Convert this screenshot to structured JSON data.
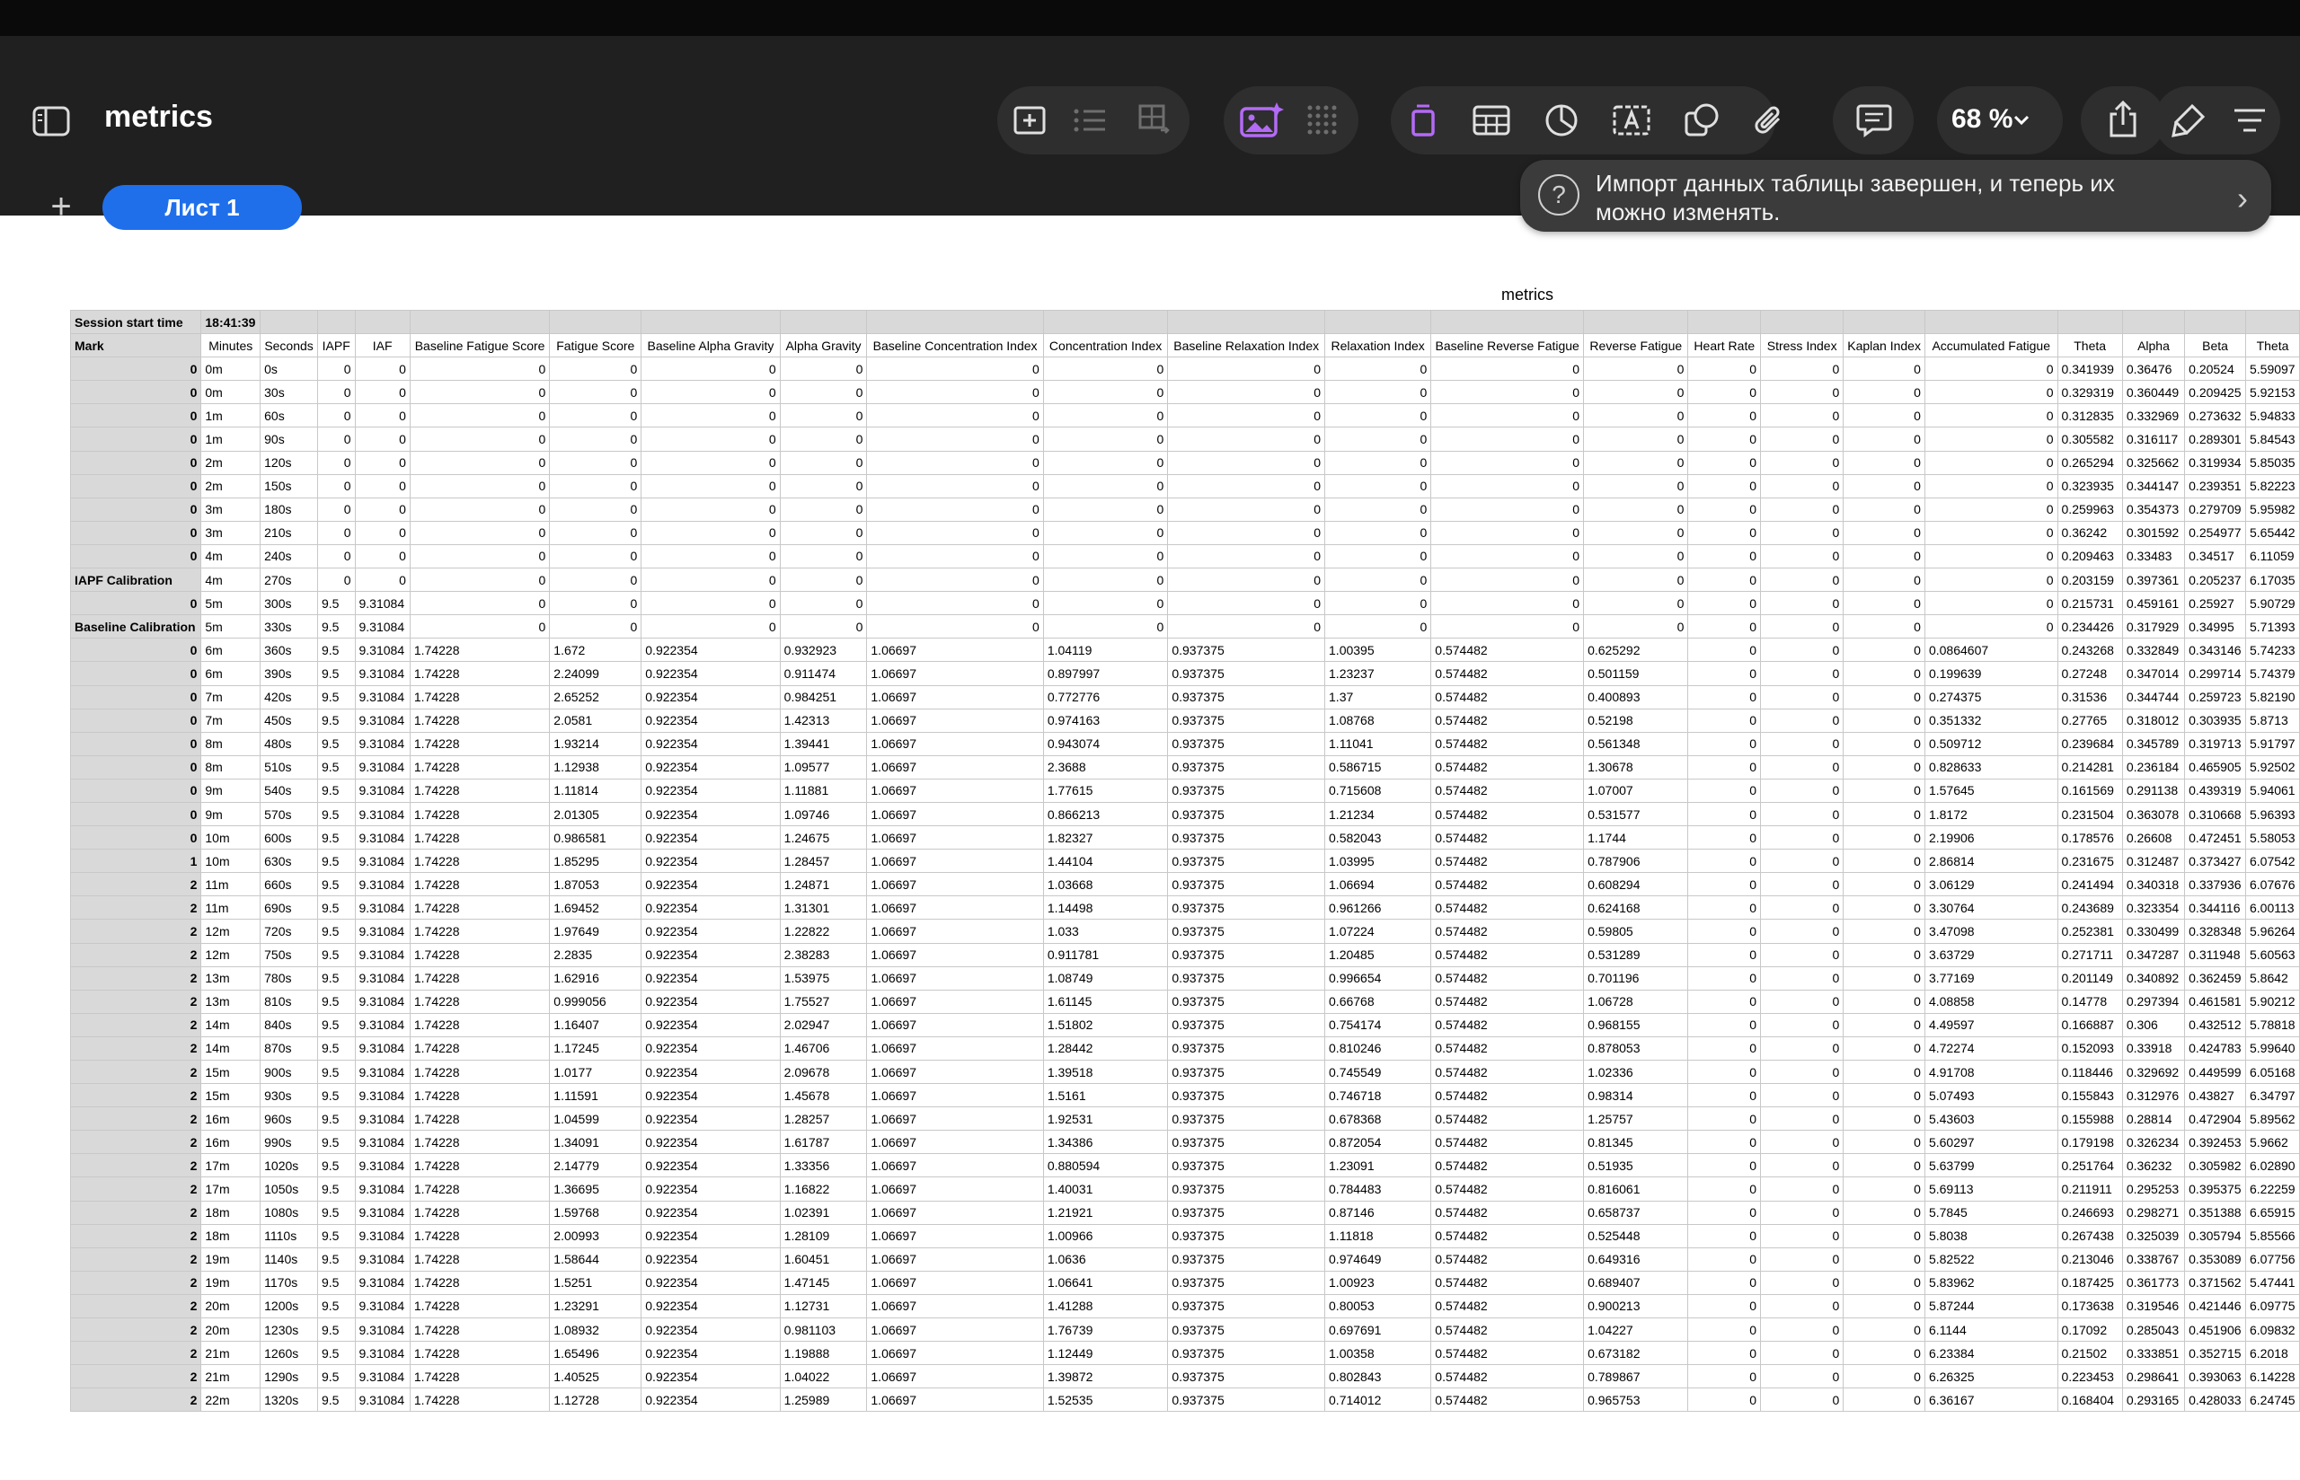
{
  "app": {
    "document_title": "metrics",
    "zoom_label": "68 %",
    "sheet_tab_label": "Лист 1",
    "notice_text": "Импорт данных таблицы завершен, и теперь их можно изменять."
  },
  "icons": {
    "sidebar": "sidebar-icon",
    "insert": "insert-icon",
    "list": "list-icon",
    "table_ops": "table-ops-icon",
    "image": "image-ai-icon",
    "grid": "grid-icon",
    "page": "page-icon",
    "table": "table-icon",
    "chart": "chart-icon",
    "textbox": "text-box-icon",
    "shape": "shape-icon",
    "attach": "paperclip-icon",
    "comment": "comment-icon",
    "share": "share-icon",
    "format": "format-brush-icon",
    "menu": "menu-icon"
  },
  "colors": {
    "accent": "#1f6feb",
    "image_icon": "#b36bf5",
    "header_gray": "#d9d9d9"
  },
  "sheet": {
    "title": "metrics",
    "session_label": "Session start time",
    "session_value": "18:41:39",
    "headers": [
      "Mark",
      "Minutes",
      "Seconds",
      "IAPF",
      "IAF",
      "Baseline Fatigue Score",
      "Fatigue Score",
      "Baseline Alpha Gravity",
      "Alpha Gravity",
      "Baseline Concentration Index",
      "Concentration Index",
      "Baseline Relaxation Index",
      "Relaxation Index",
      "Baseline Reverse Fatigue",
      "Reverse Fatigue",
      "Heart Rate",
      "Stress Index",
      "Kaplan Index",
      "Accumulated Fatigue",
      "Theta",
      "Alpha",
      "Beta",
      "Theta"
    ],
    "rows": [
      [
        "0",
        "0m",
        "0s",
        "0",
        "0",
        "0",
        "0",
        "0",
        "0",
        "0",
        "0",
        "0",
        "0",
        "0",
        "0",
        "0",
        "0",
        "0",
        "0",
        "0.341939",
        "0.36476",
        "0.20524",
        "5.59097"
      ],
      [
        "0",
        "0m",
        "30s",
        "0",
        "0",
        "0",
        "0",
        "0",
        "0",
        "0",
        "0",
        "0",
        "0",
        "0",
        "0",
        "0",
        "0",
        "0",
        "0",
        "0.329319",
        "0.360449",
        "0.209425",
        "5.92153"
      ],
      [
        "0",
        "1m",
        "60s",
        "0",
        "0",
        "0",
        "0",
        "0",
        "0",
        "0",
        "0",
        "0",
        "0",
        "0",
        "0",
        "0",
        "0",
        "0",
        "0",
        "0.312835",
        "0.332969",
        "0.273632",
        "5.94833"
      ],
      [
        "0",
        "1m",
        "90s",
        "0",
        "0",
        "0",
        "0",
        "0",
        "0",
        "0",
        "0",
        "0",
        "0",
        "0",
        "0",
        "0",
        "0",
        "0",
        "0",
        "0.305582",
        "0.316117",
        "0.289301",
        "5.84543"
      ],
      [
        "0",
        "2m",
        "120s",
        "0",
        "0",
        "0",
        "0",
        "0",
        "0",
        "0",
        "0",
        "0",
        "0",
        "0",
        "0",
        "0",
        "0",
        "0",
        "0",
        "0.265294",
        "0.325662",
        "0.319934",
        "5.85035"
      ],
      [
        "0",
        "2m",
        "150s",
        "0",
        "0",
        "0",
        "0",
        "0",
        "0",
        "0",
        "0",
        "0",
        "0",
        "0",
        "0",
        "0",
        "0",
        "0",
        "0",
        "0.323935",
        "0.344147",
        "0.239351",
        "5.82223"
      ],
      [
        "0",
        "3m",
        "180s",
        "0",
        "0",
        "0",
        "0",
        "0",
        "0",
        "0",
        "0",
        "0",
        "0",
        "0",
        "0",
        "0",
        "0",
        "0",
        "0",
        "0.259963",
        "0.354373",
        "0.279709",
        "5.95982"
      ],
      [
        "0",
        "3m",
        "210s",
        "0",
        "0",
        "0",
        "0",
        "0",
        "0",
        "0",
        "0",
        "0",
        "0",
        "0",
        "0",
        "0",
        "0",
        "0",
        "0",
        "0.36242",
        "0.301592",
        "0.254977",
        "5.65442"
      ],
      [
        "0",
        "4m",
        "240s",
        "0",
        "0",
        "0",
        "0",
        "0",
        "0",
        "0",
        "0",
        "0",
        "0",
        "0",
        "0",
        "0",
        "0",
        "0",
        "0",
        "0.209463",
        "0.33483",
        "0.34517",
        "6.11059"
      ],
      [
        "IAPF Calibration",
        "4m",
        "270s",
        "0",
        "0",
        "0",
        "0",
        "0",
        "0",
        "0",
        "0",
        "0",
        "0",
        "0",
        "0",
        "0",
        "0",
        "0",
        "0",
        "0.203159",
        "0.397361",
        "0.205237",
        "6.17035"
      ],
      [
        "0",
        "5m",
        "300s",
        "9.5",
        "9.31084",
        "0",
        "0",
        "0",
        "0",
        "0",
        "0",
        "0",
        "0",
        "0",
        "0",
        "0",
        "0",
        "0",
        "0",
        "0.215731",
        "0.459161",
        "0.25927",
        "5.90729"
      ],
      [
        "Baseline Calibration",
        "5m",
        "330s",
        "9.5",
        "9.31084",
        "0",
        "0",
        "0",
        "0",
        "0",
        "0",
        "0",
        "0",
        "0",
        "0",
        "0",
        "0",
        "0",
        "0",
        "0.234426",
        "0.317929",
        "0.34995",
        "5.71393"
      ],
      [
        "0",
        "6m",
        "360s",
        "9.5",
        "9.31084",
        "1.74228",
        "1.672",
        "0.922354",
        "0.932923",
        "1.06697",
        "1.04119",
        "0.937375",
        "1.00395",
        "0.574482",
        "0.625292",
        "0",
        "0",
        "0",
        "0.0864607",
        "0.243268",
        "0.332849",
        "0.343146",
        "5.74233"
      ],
      [
        "0",
        "6m",
        "390s",
        "9.5",
        "9.31084",
        "1.74228",
        "2.24099",
        "0.922354",
        "0.911474",
        "1.06697",
        "0.897997",
        "0.937375",
        "1.23237",
        "0.574482",
        "0.501159",
        "0",
        "0",
        "0",
        "0.199639",
        "0.27248",
        "0.347014",
        "0.299714",
        "5.74379"
      ],
      [
        "0",
        "7m",
        "420s",
        "9.5",
        "9.31084",
        "1.74228",
        "2.65252",
        "0.922354",
        "0.984251",
        "1.06697",
        "0.772776",
        "0.937375",
        "1.37",
        "0.574482",
        "0.400893",
        "0",
        "0",
        "0",
        "0.274375",
        "0.31536",
        "0.344744",
        "0.259723",
        "5.82190"
      ],
      [
        "0",
        "7m",
        "450s",
        "9.5",
        "9.31084",
        "1.74228",
        "2.0581",
        "0.922354",
        "1.42313",
        "1.06697",
        "0.974163",
        "0.937375",
        "1.08768",
        "0.574482",
        "0.52198",
        "0",
        "0",
        "0",
        "0.351332",
        "0.27765",
        "0.318012",
        "0.303935",
        "5.8713"
      ],
      [
        "0",
        "8m",
        "480s",
        "9.5",
        "9.31084",
        "1.74228",
        "1.93214",
        "0.922354",
        "1.39441",
        "1.06697",
        "0.943074",
        "0.937375",
        "1.11041",
        "0.574482",
        "0.561348",
        "0",
        "0",
        "0",
        "0.509712",
        "0.239684",
        "0.345789",
        "0.319713",
        "5.91797"
      ],
      [
        "0",
        "8m",
        "510s",
        "9.5",
        "9.31084",
        "1.74228",
        "1.12938",
        "0.922354",
        "1.09577",
        "1.06697",
        "2.3688",
        "0.937375",
        "0.586715",
        "0.574482",
        "1.30678",
        "0",
        "0",
        "0",
        "0.828633",
        "0.214281",
        "0.236184",
        "0.465905",
        "5.92502"
      ],
      [
        "0",
        "9m",
        "540s",
        "9.5",
        "9.31084",
        "1.74228",
        "1.11814",
        "0.922354",
        "1.11881",
        "1.06697",
        "1.77615",
        "0.937375",
        "0.715608",
        "0.574482",
        "1.07007",
        "0",
        "0",
        "0",
        "1.57645",
        "0.161569",
        "0.291138",
        "0.439319",
        "5.94061"
      ],
      [
        "0",
        "9m",
        "570s",
        "9.5",
        "9.31084",
        "1.74228",
        "2.01305",
        "0.922354",
        "1.09746",
        "1.06697",
        "0.866213",
        "0.937375",
        "1.21234",
        "0.574482",
        "0.531577",
        "0",
        "0",
        "0",
        "1.8172",
        "0.231504",
        "0.363078",
        "0.310668",
        "5.96393"
      ],
      [
        "0",
        "10m",
        "600s",
        "9.5",
        "9.31084",
        "1.74228",
        "0.986581",
        "0.922354",
        "1.24675",
        "1.06697",
        "1.82327",
        "0.937375",
        "0.582043",
        "0.574482",
        "1.1744",
        "0",
        "0",
        "0",
        "2.19906",
        "0.178576",
        "0.26608",
        "0.472451",
        "5.58053"
      ],
      [
        "1",
        "10m",
        "630s",
        "9.5",
        "9.31084",
        "1.74228",
        "1.85295",
        "0.922354",
        "1.28457",
        "1.06697",
        "1.44104",
        "0.937375",
        "1.03995",
        "0.574482",
        "0.787906",
        "0",
        "0",
        "0",
        "2.86814",
        "0.231675",
        "0.312487",
        "0.373427",
        "6.07542"
      ],
      [
        "2",
        "11m",
        "660s",
        "9.5",
        "9.31084",
        "1.74228",
        "1.87053",
        "0.922354",
        "1.24871",
        "1.06697",
        "1.03668",
        "0.937375",
        "1.06694",
        "0.574482",
        "0.608294",
        "0",
        "0",
        "0",
        "3.06129",
        "0.241494",
        "0.340318",
        "0.337936",
        "6.07676"
      ],
      [
        "2",
        "11m",
        "690s",
        "9.5",
        "9.31084",
        "1.74228",
        "1.69452",
        "0.922354",
        "1.31301",
        "1.06697",
        "1.14498",
        "0.937375",
        "0.961266",
        "0.574482",
        "0.624168",
        "0",
        "0",
        "0",
        "3.30764",
        "0.243689",
        "0.323354",
        "0.344116",
        "6.00113"
      ],
      [
        "2",
        "12m",
        "720s",
        "9.5",
        "9.31084",
        "1.74228",
        "1.97649",
        "0.922354",
        "1.22822",
        "1.06697",
        "1.033",
        "0.937375",
        "1.07224",
        "0.574482",
        "0.59805",
        "0",
        "0",
        "0",
        "3.47098",
        "0.252381",
        "0.330499",
        "0.328348",
        "5.96264"
      ],
      [
        "2",
        "12m",
        "750s",
        "9.5",
        "9.31084",
        "1.74228",
        "2.2835",
        "0.922354",
        "2.38283",
        "1.06697",
        "0.911781",
        "0.937375",
        "1.20485",
        "0.574482",
        "0.531289",
        "0",
        "0",
        "0",
        "3.63729",
        "0.271711",
        "0.347287",
        "0.311948",
        "5.60563"
      ],
      [
        "2",
        "13m",
        "780s",
        "9.5",
        "9.31084",
        "1.74228",
        "1.62916",
        "0.922354",
        "1.53975",
        "1.06697",
        "1.08749",
        "0.937375",
        "0.996654",
        "0.574482",
        "0.701196",
        "0",
        "0",
        "0",
        "3.77169",
        "0.201149",
        "0.340892",
        "0.362459",
        "5.8642"
      ],
      [
        "2",
        "13m",
        "810s",
        "9.5",
        "9.31084",
        "1.74228",
        "0.999056",
        "0.922354",
        "1.75527",
        "1.06697",
        "1.61145",
        "0.937375",
        "0.66768",
        "0.574482",
        "1.06728",
        "0",
        "0",
        "0",
        "4.08858",
        "0.14778",
        "0.297394",
        "0.461581",
        "5.90212"
      ],
      [
        "2",
        "14m",
        "840s",
        "9.5",
        "9.31084",
        "1.74228",
        "1.16407",
        "0.922354",
        "2.02947",
        "1.06697",
        "1.51802",
        "0.937375",
        "0.754174",
        "0.574482",
        "0.968155",
        "0",
        "0",
        "0",
        "4.49597",
        "0.166887",
        "0.306",
        "0.432512",
        "5.78818"
      ],
      [
        "2",
        "14m",
        "870s",
        "9.5",
        "9.31084",
        "1.74228",
        "1.17245",
        "0.922354",
        "1.46706",
        "1.06697",
        "1.28442",
        "0.937375",
        "0.810246",
        "0.574482",
        "0.878053",
        "0",
        "0",
        "0",
        "4.72274",
        "0.152093",
        "0.33918",
        "0.424783",
        "5.99640"
      ],
      [
        "2",
        "15m",
        "900s",
        "9.5",
        "9.31084",
        "1.74228",
        "1.0177",
        "0.922354",
        "2.09678",
        "1.06697",
        "1.39518",
        "0.937375",
        "0.745549",
        "0.574482",
        "1.02336",
        "0",
        "0",
        "0",
        "4.91708",
        "0.118446",
        "0.329692",
        "0.449599",
        "6.05168"
      ],
      [
        "2",
        "15m",
        "930s",
        "9.5",
        "9.31084",
        "1.74228",
        "1.11591",
        "0.922354",
        "1.45678",
        "1.06697",
        "1.5161",
        "0.937375",
        "0.746718",
        "0.574482",
        "0.98314",
        "0",
        "0",
        "0",
        "5.07493",
        "0.155843",
        "0.312976",
        "0.43827",
        "6.34797"
      ],
      [
        "2",
        "16m",
        "960s",
        "9.5",
        "9.31084",
        "1.74228",
        "1.04599",
        "0.922354",
        "1.28257",
        "1.06697",
        "1.92531",
        "0.937375",
        "0.678368",
        "0.574482",
        "1.25757",
        "0",
        "0",
        "0",
        "5.43603",
        "0.155988",
        "0.28814",
        "0.472904",
        "5.89562"
      ],
      [
        "2",
        "16m",
        "990s",
        "9.5",
        "9.31084",
        "1.74228",
        "1.34091",
        "0.922354",
        "1.61787",
        "1.06697",
        "1.34386",
        "0.937375",
        "0.872054",
        "0.574482",
        "0.81345",
        "0",
        "0",
        "0",
        "5.60297",
        "0.179198",
        "0.326234",
        "0.392453",
        "5.9662"
      ],
      [
        "2",
        "17m",
        "1020s",
        "9.5",
        "9.31084",
        "1.74228",
        "2.14779",
        "0.922354",
        "1.33356",
        "1.06697",
        "0.880594",
        "0.937375",
        "1.23091",
        "0.574482",
        "0.51935",
        "0",
        "0",
        "0",
        "5.63799",
        "0.251764",
        "0.36232",
        "0.305982",
        "6.02890"
      ],
      [
        "2",
        "17m",
        "1050s",
        "9.5",
        "9.31084",
        "1.74228",
        "1.36695",
        "0.922354",
        "1.16822",
        "1.06697",
        "1.40031",
        "0.937375",
        "0.784483",
        "0.574482",
        "0.816061",
        "0",
        "0",
        "0",
        "5.69113",
        "0.211911",
        "0.295253",
        "0.395375",
        "6.22259"
      ],
      [
        "2",
        "18m",
        "1080s",
        "9.5",
        "9.31084",
        "1.74228",
        "1.59768",
        "0.922354",
        "1.02391",
        "1.06697",
        "1.21921",
        "0.937375",
        "0.87146",
        "0.574482",
        "0.658737",
        "0",
        "0",
        "0",
        "5.7845",
        "0.246693",
        "0.298271",
        "0.351388",
        "6.65915"
      ],
      [
        "2",
        "18m",
        "1110s",
        "9.5",
        "9.31084",
        "1.74228",
        "2.00993",
        "0.922354",
        "1.28109",
        "1.06697",
        "1.00966",
        "0.937375",
        "1.11818",
        "0.574482",
        "0.525448",
        "0",
        "0",
        "0",
        "5.8038",
        "0.267438",
        "0.325039",
        "0.305794",
        "5.85566"
      ],
      [
        "2",
        "19m",
        "1140s",
        "9.5",
        "9.31084",
        "1.74228",
        "1.58644",
        "0.922354",
        "1.60451",
        "1.06697",
        "1.0636",
        "0.937375",
        "0.974649",
        "0.574482",
        "0.649316",
        "0",
        "0",
        "0",
        "5.82522",
        "0.213046",
        "0.338767",
        "0.353089",
        "6.07756"
      ],
      [
        "2",
        "19m",
        "1170s",
        "9.5",
        "9.31084",
        "1.74228",
        "1.5251",
        "0.922354",
        "1.47145",
        "1.06697",
        "1.06641",
        "0.937375",
        "1.00923",
        "0.574482",
        "0.689407",
        "0",
        "0",
        "0",
        "5.83962",
        "0.187425",
        "0.361773",
        "0.371562",
        "5.47441"
      ],
      [
        "2",
        "20m",
        "1200s",
        "9.5",
        "9.31084",
        "1.74228",
        "1.23291",
        "0.922354",
        "1.12731",
        "1.06697",
        "1.41288",
        "0.937375",
        "0.80053",
        "0.574482",
        "0.900213",
        "0",
        "0",
        "0",
        "5.87244",
        "0.173638",
        "0.319546",
        "0.421446",
        "6.09775"
      ],
      [
        "2",
        "20m",
        "1230s",
        "9.5",
        "9.31084",
        "1.74228",
        "1.08932",
        "0.922354",
        "0.981103",
        "1.06697",
        "1.76739",
        "0.937375",
        "0.697691",
        "0.574482",
        "1.04227",
        "0",
        "0",
        "0",
        "6.1144",
        "0.17092",
        "0.285043",
        "0.451906",
        "6.09832"
      ],
      [
        "2",
        "21m",
        "1260s",
        "9.5",
        "9.31084",
        "1.74228",
        "1.65496",
        "0.922354",
        "1.19888",
        "1.06697",
        "1.12449",
        "0.937375",
        "1.00358",
        "0.574482",
        "0.673182",
        "0",
        "0",
        "0",
        "6.23384",
        "0.21502",
        "0.333851",
        "0.352715",
        "6.2018"
      ],
      [
        "2",
        "21m",
        "1290s",
        "9.5",
        "9.31084",
        "1.74228",
        "1.40525",
        "0.922354",
        "1.04022",
        "1.06697",
        "1.39872",
        "0.937375",
        "0.802843",
        "0.574482",
        "0.789867",
        "0",
        "0",
        "0",
        "6.26325",
        "0.223453",
        "0.298641",
        "0.393063",
        "6.14228"
      ],
      [
        "2",
        "22m",
        "1320s",
        "9.5",
        "9.31084",
        "1.74228",
        "1.12728",
        "0.922354",
        "1.25989",
        "1.06697",
        "1.52535",
        "0.937375",
        "0.714012",
        "0.574482",
        "0.965753",
        "0",
        "0",
        "0",
        "6.36167",
        "0.168404",
        "0.293165",
        "0.428033",
        "6.24745"
      ]
    ]
  }
}
